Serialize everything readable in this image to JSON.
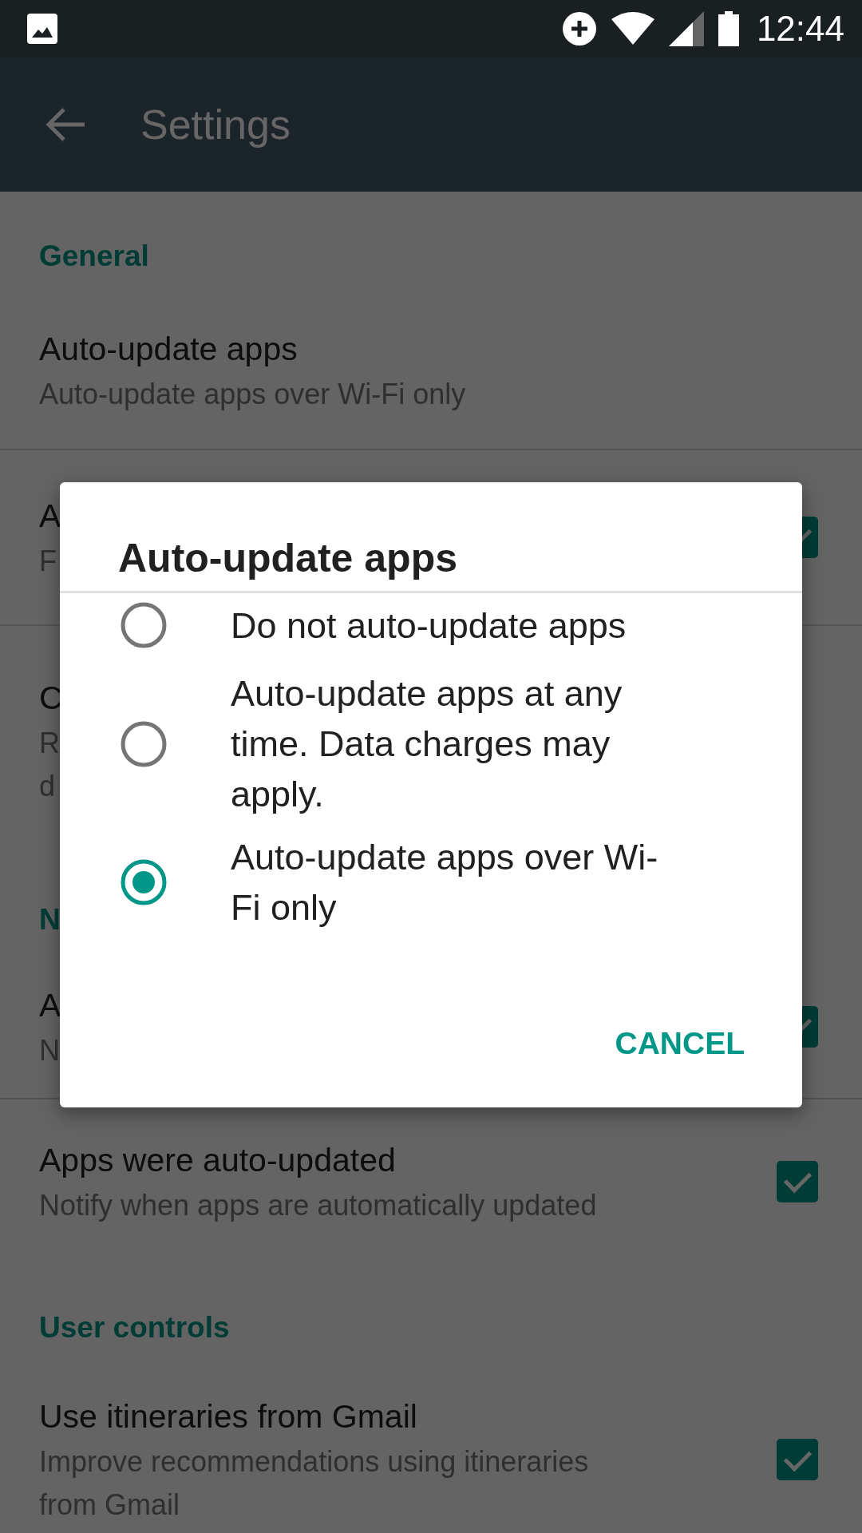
{
  "status_bar": {
    "time": "12:44"
  },
  "app_bar": {
    "title": "Settings"
  },
  "sections": [
    {
      "header": "General",
      "rows": [
        {
          "kind": "plain",
          "title": "Auto-update apps",
          "lines": [
            "Auto-update apps over Wi-Fi only"
          ]
        },
        {
          "kind": "checkbox",
          "title": "A",
          "lines": [
            "F"
          ],
          "checked": true
        },
        {
          "kind": "plain",
          "title": "C",
          "lines": [
            "R",
            "d"
          ]
        }
      ]
    },
    {
      "header": "N",
      "rows": [
        {
          "kind": "checkbox",
          "title": "A",
          "lines": [
            "N"
          ],
          "checked": true
        },
        {
          "kind": "checkbox",
          "title": "Apps were auto-updated",
          "lines": [
            "Notify when apps are automatically updated"
          ],
          "checked": true
        }
      ]
    },
    {
      "header": "User controls",
      "rows": [
        {
          "kind": "checkbox",
          "title": "Use itineraries from Gmail",
          "lines": [
            "Improve recommendations using itineraries",
            "from Gmail"
          ],
          "checked": true
        }
      ]
    }
  ],
  "dialog": {
    "title": "Auto-update apps",
    "options": [
      {
        "label": "Do not auto-update apps",
        "selected": false
      },
      {
        "label": "Auto-update apps at any time. Data charges may apply.",
        "selected": false
      },
      {
        "label": "Auto-update apps over Wi-Fi only",
        "selected": true
      }
    ],
    "buttons": [
      "CANCEL"
    ]
  }
}
